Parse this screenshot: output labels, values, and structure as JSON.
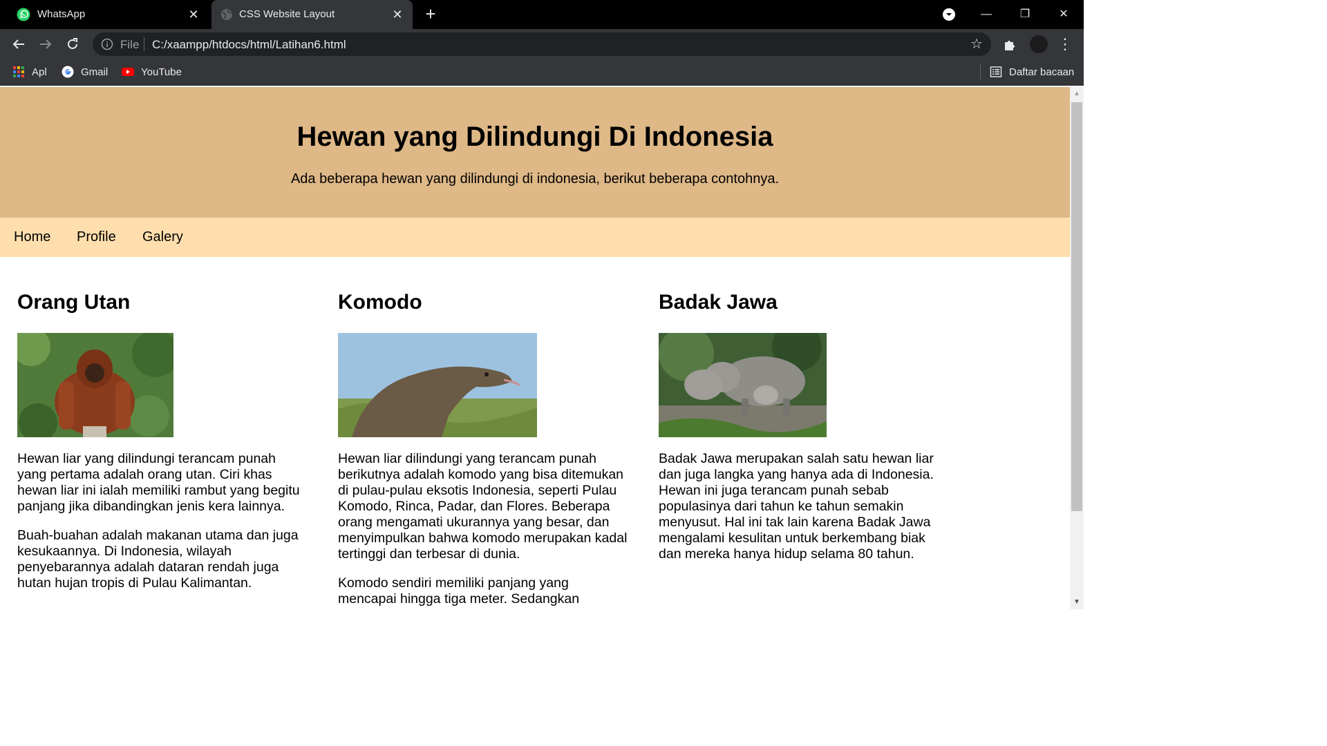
{
  "browser": {
    "tabs": [
      {
        "title": "WhatsApp",
        "favicon": "whatsapp-icon",
        "active": false
      },
      {
        "title": "CSS Website Layout",
        "favicon": "globe-icon",
        "active": true
      }
    ],
    "address": {
      "scheme_label": "File",
      "url": "C:/xaampp/htdocs/html/Latihan6.html"
    },
    "bookmarks": [
      {
        "label": "Apl",
        "icon": "apps-grid-icon"
      },
      {
        "label": "Gmail",
        "icon": "google-icon"
      },
      {
        "label": "YouTube",
        "icon": "youtube-icon"
      }
    ],
    "reading_list": "Daftar bacaan"
  },
  "page": {
    "header": {
      "title": "Hewan yang Dilindungi Di Indonesia",
      "subtitle": "Ada beberapa hewan yang dilindungi di indonesia, berikut beberapa contohnya."
    },
    "nav": [
      "Home",
      "Profile",
      "Galery"
    ],
    "columns": [
      {
        "title": "Orang Utan",
        "image": "orangutan-photo",
        "paragraphs": [
          "Hewan liar yang dilindungi terancam punah yang pertama adalah orang utan. Ciri khas hewan liar ini ialah memiliki rambut yang begitu panjang jika dibandingkan jenis kera lainnya.",
          "Buah-buahan adalah makanan utama dan juga kesukaannya. Di Indonesia, wilayah penyebarannya adalah dataran rendah juga hutan hujan tropis di Pulau Kalimantan."
        ]
      },
      {
        "title": "Komodo",
        "image": "komodo-photo",
        "paragraphs": [
          "Hewan liar dilindungi yang terancam punah berikutnya adalah komodo yang bisa ditemukan di pulau-pulau eksotis Indonesia, seperti Pulau Komodo, Rinca, Padar, dan Flores. Beberapa orang mengamati ukurannya yang besar, dan menyimpulkan bahwa komodo merupakan kadal tertinggi dan terbesar di dunia.",
          "Komodo sendiri memiliki panjang yang mencapai hingga tiga meter. Sedangkan"
        ]
      },
      {
        "title": "Badak Jawa",
        "image": "javan-rhino-photo",
        "paragraphs": [
          "Badak Jawa merupakan salah satu hewan liar dan juga langka yang hanya ada di Indonesia. Hewan ini juga terancam punah sebab populasinya dari tahun ke tahun semakin menyusut. Hal ini tak lain karena Badak Jawa mengalami kesulitan untuk berkembang biak dan mereka hanya hidup selama 80 tahun."
        ]
      }
    ]
  },
  "colors": {
    "header_bg": "#deb887",
    "nav_bg": "#ffdead",
    "chrome_dark": "#35363a"
  }
}
